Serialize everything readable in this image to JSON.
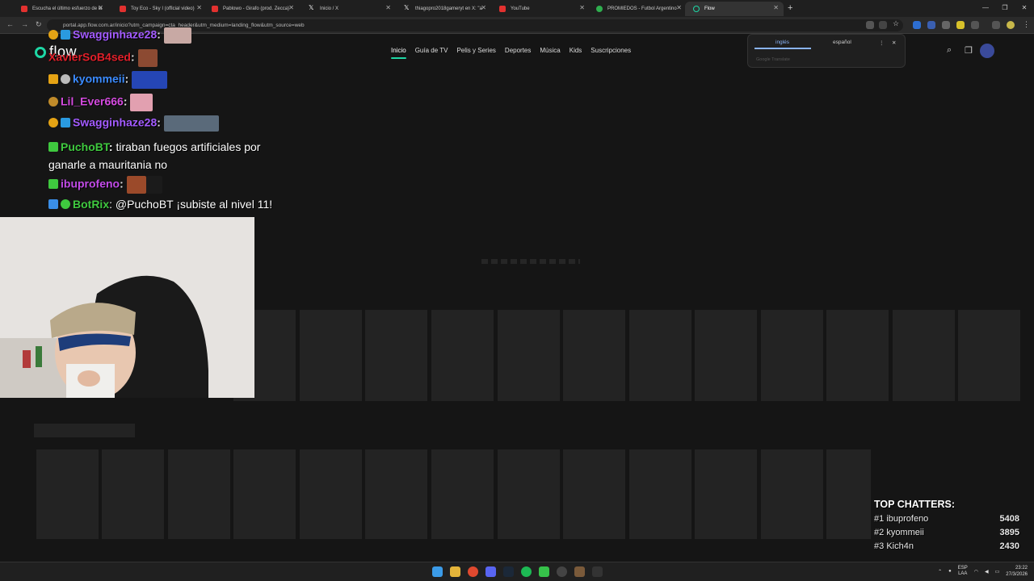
{
  "browser": {
    "tabs": [
      {
        "title": "Escucha el último esfuerzo de la",
        "active": false
      },
      {
        "title": "Toy Eco - Sky I (official video)",
        "active": false
      },
      {
        "title": "Pablowo - Girafo (prod. Zecca)",
        "active": false
      },
      {
        "title": "Inicio / X",
        "active": false
      },
      {
        "title": "thiagopro2018gameryt en X: \"a",
        "active": false
      },
      {
        "title": "YouTube",
        "active": false
      },
      {
        "title": "PROMIEDOS - Futbol Argentino",
        "active": false
      },
      {
        "title": "Flow",
        "active": true
      }
    ],
    "url": "portal.app.flow.com.ar/inicio?utm_campaign=cta_header&utm_medium=landing_flow&utm_source=web",
    "translate": {
      "lang_from": "inglés",
      "lang_to": "español",
      "footer": "Google Translate"
    }
  },
  "flow": {
    "logo": "flow",
    "nav": [
      "Inicio",
      "Guía de TV",
      "Pelis y Series",
      "Deportes",
      "Música",
      "Kids",
      "Suscripciones"
    ],
    "accent": "#1ed7a5"
  },
  "chat": [
    {
      "user": "Swagginhaze28",
      "color": "#a35bff",
      "text": ""
    },
    {
      "user": "XavierSoB4sed",
      "color": "#e0202a",
      "text": ""
    },
    {
      "user": "kyommeii",
      "color": "#3b8bff",
      "text": ""
    },
    {
      "user": "Lil_Ever666",
      "color": "#d54be0",
      "text": ""
    },
    {
      "user": "Swagginhaze28",
      "color": "#a35bff",
      "text": ""
    },
    {
      "user": "PuchoBT",
      "color": "#3fc93f",
      "text": "tiraban fuegos artificiales por ganarle a mauritania no"
    },
    {
      "user": "ibuprofeno",
      "color": "#c24be8",
      "text": ""
    },
    {
      "user": "BotRix",
      "color": "#3fc93f",
      "text": "@PuchoBT ¡subiste al nivel 11!"
    }
  ],
  "top_chatters": {
    "title": "TOP CHATTERS:",
    "rows": [
      {
        "rank": "#1",
        "name": "ibuprofeno",
        "count": "5408"
      },
      {
        "rank": "#2",
        "name": "kyommeii",
        "count": "3895"
      },
      {
        "rank": "#3",
        "name": "Kich4n",
        "count": "2430"
      }
    ]
  },
  "taskbar": {
    "lang": "ESP",
    "layout": "LAA",
    "time": "23:22",
    "date": "27/3/2026"
  }
}
